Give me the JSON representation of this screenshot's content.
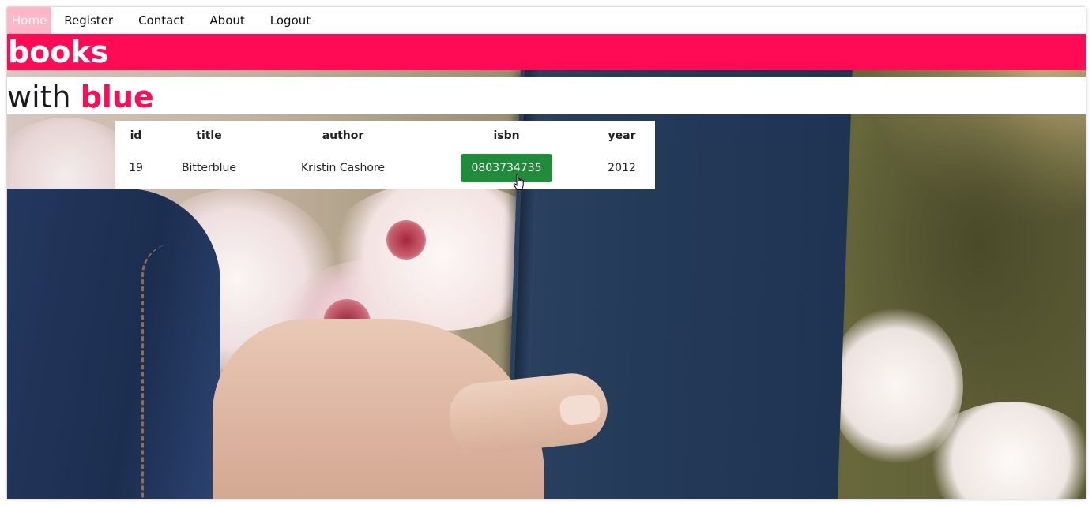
{
  "nav": {
    "items": [
      {
        "label": "Home",
        "active": true
      },
      {
        "label": "Register",
        "active": false
      },
      {
        "label": "Contact",
        "active": false
      },
      {
        "label": "About",
        "active": false
      },
      {
        "label": "Logout",
        "active": false
      }
    ]
  },
  "header": {
    "title": "books",
    "subtitle_prefix": "with",
    "subtitle_accent": "blue"
  },
  "table": {
    "columns": [
      "id",
      "title",
      "author",
      "isbn",
      "year"
    ],
    "rows": [
      {
        "id": "19",
        "title": "Bitterblue",
        "author": "Kristin Cashore",
        "isbn": "0803734735",
        "year": "2012"
      }
    ]
  },
  "colors": {
    "accent": "#ff0a55",
    "nav_active_bg": "#ffb6c8",
    "isbn_button": "#1f8b3b"
  },
  "icons": {
    "cursor": "hand-pointer-icon"
  }
}
